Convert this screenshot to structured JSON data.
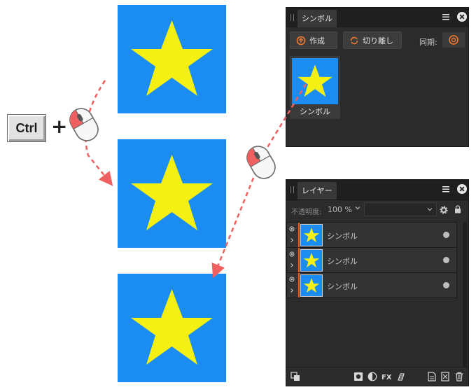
{
  "keys": {
    "modifier": "Ctrl",
    "plus": "+"
  },
  "symbols_panel": {
    "tab": "シンボル",
    "create_button": "作成",
    "detach_button": "切り離し",
    "sync_label": "同期:",
    "symbol_item_label": "シンボル",
    "icons": [
      "menu-icon",
      "close-icon",
      "create-icon",
      "detach-icon",
      "sync-icon"
    ]
  },
  "layers_panel": {
    "tab": "レイヤー",
    "opacity_label": "不透明度:",
    "opacity_value": "100 %",
    "blend_mode": "",
    "rows": [
      {
        "name": "シンボル"
      },
      {
        "name": "シンボル"
      },
      {
        "name": "シンボル"
      }
    ],
    "footer_icons": [
      "arrange-icon",
      "mask-icon",
      "adjustment-icon",
      "fx-icon",
      "brush-icon",
      "add-layer-icon",
      "group-icon",
      "trash-icon"
    ]
  },
  "colors": {
    "canvas_blue": "#1b8df2",
    "star_yellow": "#f4f014",
    "arrow_red": "#f06060",
    "panel_dark": "#2b2b2b",
    "accent_orange": "#e0682f"
  }
}
